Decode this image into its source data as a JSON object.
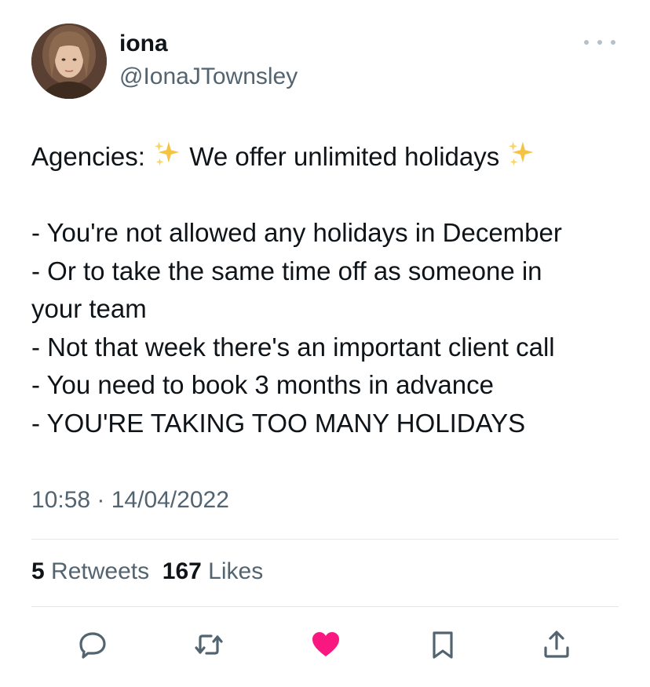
{
  "author": {
    "display_name": "iona",
    "handle": "@IonaJTownsley",
    "avatar_icon": "profile-photo"
  },
  "tweet": {
    "lines": [
      {
        "prefix": "Agencies: ",
        "middle": " We offer unlimited holidays ",
        "sparkles": true
      },
      {
        "text": ""
      },
      {
        "text": "- You're not allowed any holidays in December"
      },
      {
        "text": "- Or to take the same time off as someone in"
      },
      {
        "text": "your team"
      },
      {
        "text": "- Not that week there's an important client call"
      },
      {
        "text": "- You need to book 3 months in advance"
      },
      {
        "text": "- YOU'RE TAKING TOO MANY HOLIDAYS"
      }
    ],
    "sparkle_icon": "sparkles-emoji"
  },
  "timestamp": "10:58 · 14/04/2022",
  "stats": {
    "retweets_count": "5",
    "retweets_label": "Retweets",
    "likes_count": "167",
    "likes_label": "Likes"
  },
  "actions": {
    "reply_icon": "reply-icon",
    "retweet_icon": "retweet-icon",
    "like_icon": "heart-icon",
    "bookmark_icon": "bookmark-icon",
    "share_icon": "share-icon"
  },
  "colors": {
    "text": "#0f1419",
    "secondary": "#536471",
    "like_active": "#f91880",
    "divider": "#e4e8eb",
    "icon": "#536471"
  }
}
